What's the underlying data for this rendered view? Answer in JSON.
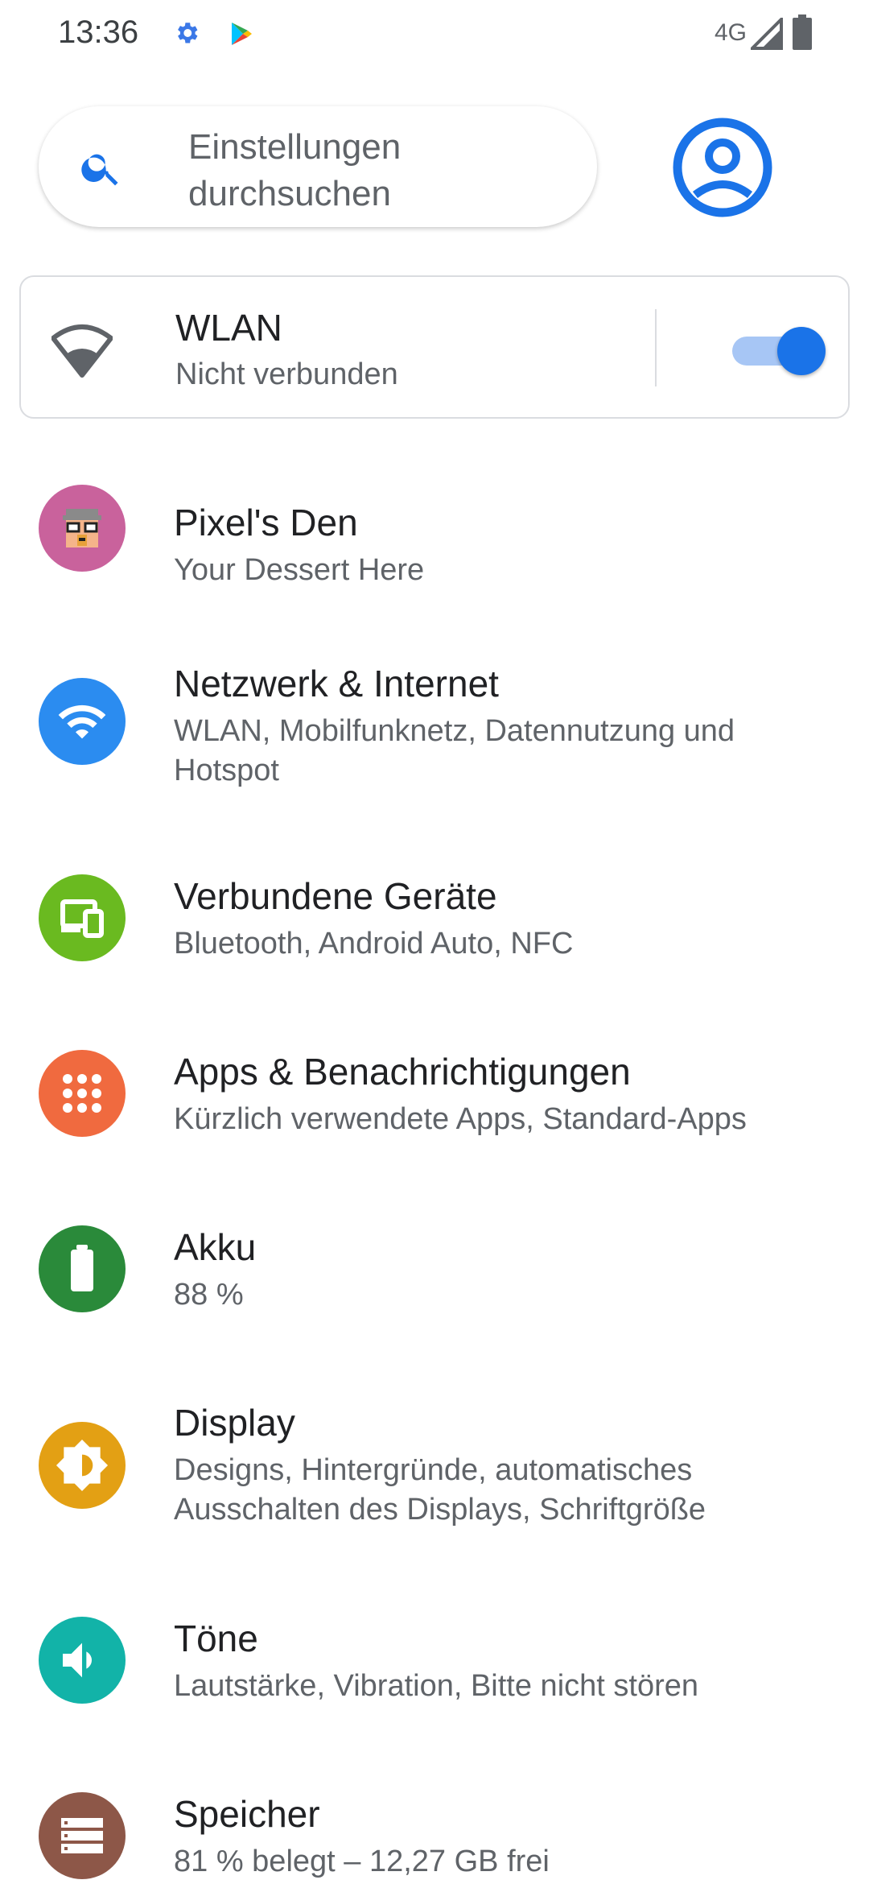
{
  "status_bar": {
    "time": "13:36",
    "network": "4G",
    "icons": [
      "settings-gear-icon",
      "play-store-icon",
      "signal-icon",
      "battery-icon"
    ]
  },
  "search": {
    "placeholder": "Einstellungen durchsuchen",
    "icon": "search-icon"
  },
  "account": {
    "icon": "account-circle-icon",
    "color": "#1a73e8"
  },
  "wlan_card": {
    "title": "WLAN",
    "subtitle": "Nicht verbunden",
    "toggle_on": true,
    "icon": "wifi-off-icon"
  },
  "items": [
    {
      "title": "Pixel's Den",
      "subtitle": "Your Dessert Here",
      "icon": "pixel-den-icon",
      "color": "#c9629c"
    },
    {
      "title": "Netzwerk & Internet",
      "subtitle": "WLAN, Mobilfunknetz, Datennutzung und Hotspot",
      "icon": "wifi-icon",
      "color": "#2b8cf0"
    },
    {
      "title": "Verbundene Geräte",
      "subtitle": "Bluetooth, Android Auto, NFC",
      "icon": "devices-icon",
      "color": "#6aba20"
    },
    {
      "title": "Apps & Benachrichtigungen",
      "subtitle": "Kürzlich verwendete Apps, Standard-Apps",
      "icon": "apps-grid-icon",
      "color": "#f06a3f"
    },
    {
      "title": "Akku",
      "subtitle": "88 %",
      "icon": "battery-icon",
      "color": "#2a8a3a"
    },
    {
      "title": "Display",
      "subtitle": "Designs, Hintergründe, automatisches Ausschalten des Displays, Schriftgröße",
      "icon": "brightness-icon",
      "color": "#e3a014"
    },
    {
      "title": "Töne",
      "subtitle": "Lautstärke, Vibration, Bitte nicht stören",
      "icon": "volume-icon",
      "color": "#12b3a8"
    },
    {
      "title": "Speicher",
      "subtitle": "81 % belegt – 12,27 GB frei",
      "icon": "storage-icon",
      "color": "#8d5748"
    }
  ]
}
